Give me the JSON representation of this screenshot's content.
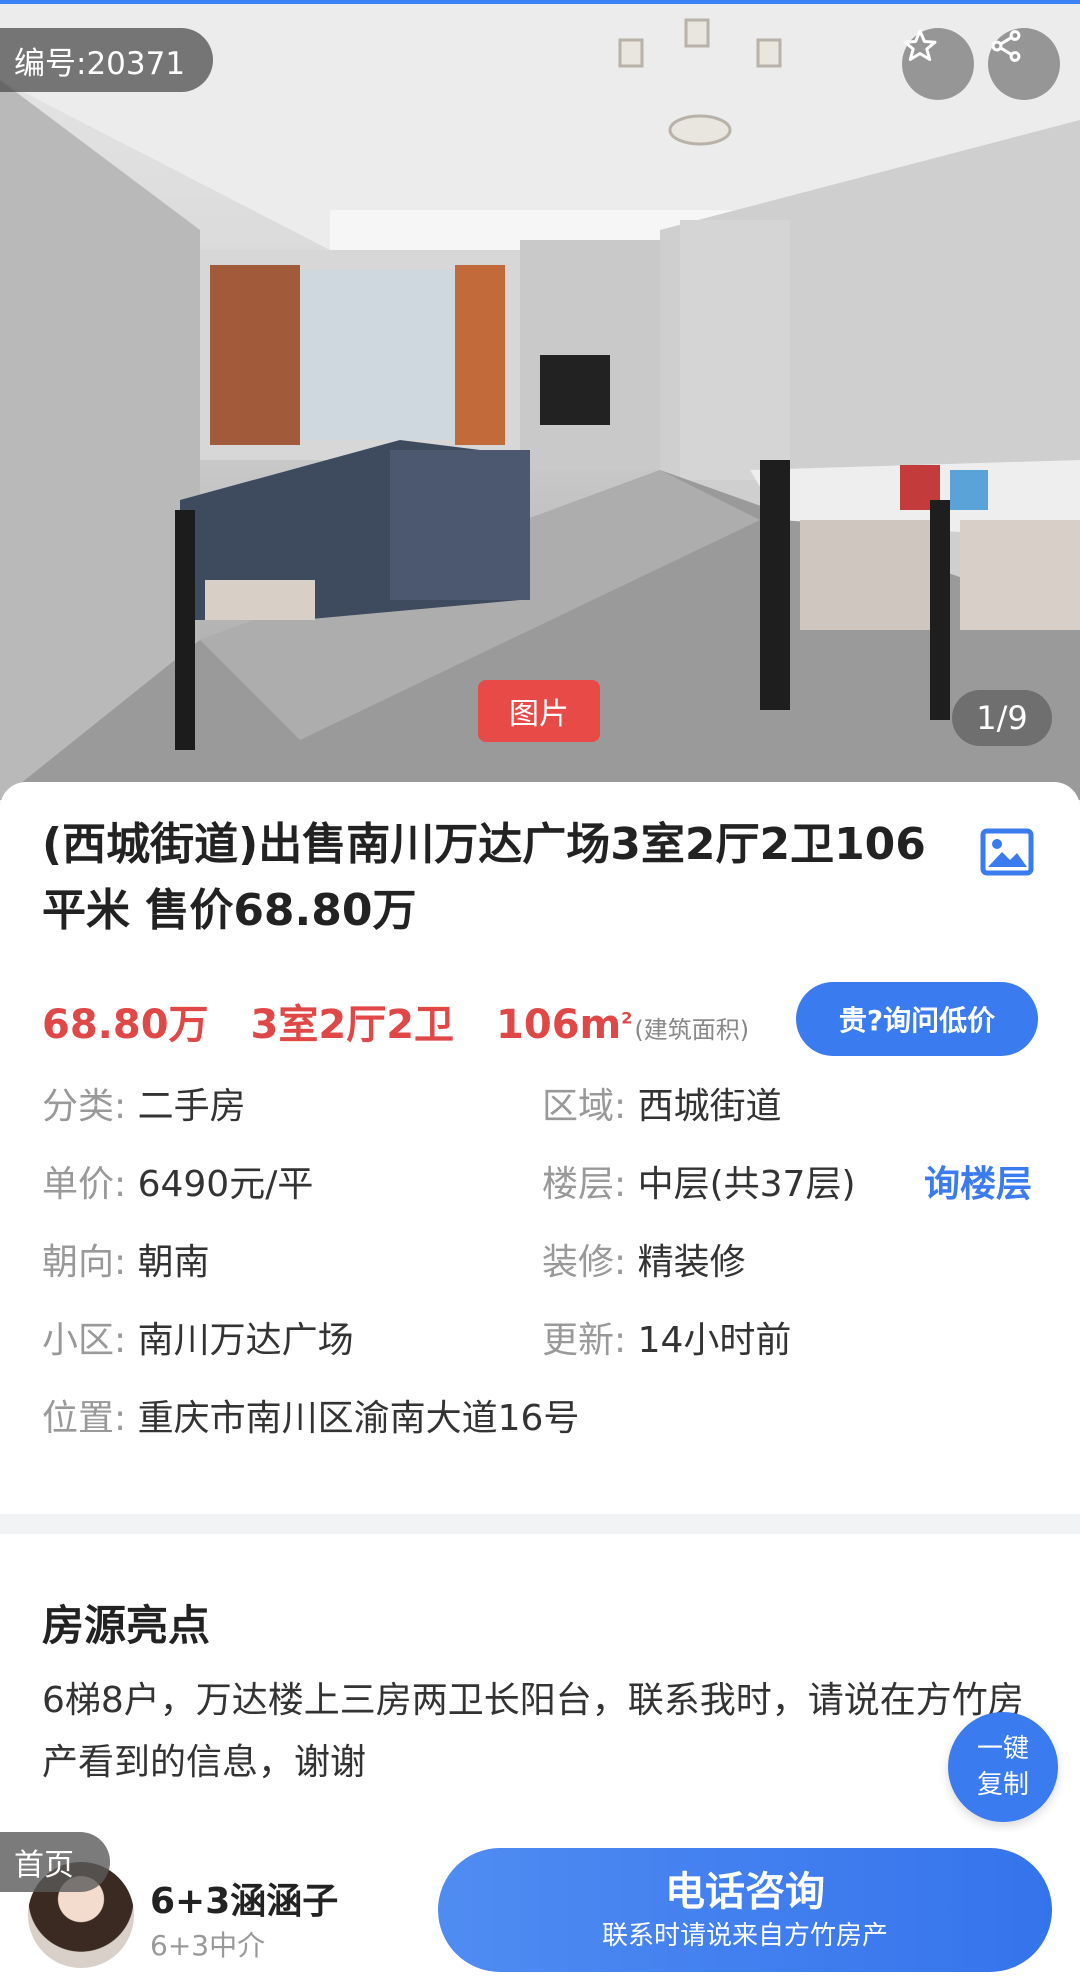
{
  "photo": {
    "code_label": "编号:20371",
    "image_tag": "图片",
    "counter": "1/9",
    "icons": [
      "star-icon",
      "share-icon"
    ]
  },
  "listing": {
    "title": "(西城街道)出售南川万达广场3室2厅2卫106平米 售价68.80万",
    "price": "68.80万",
    "layout": "3室2厅2卫",
    "area": "106m",
    "area_sup": "2",
    "area_note": "(建筑面积)",
    "ask_price_button": "贵?询问低价",
    "ask_floor_button": "询楼层",
    "attributes": [
      {
        "label": "分类:",
        "value": "二手房"
      },
      {
        "label": "区域:",
        "value": "西城街道"
      },
      {
        "label": "单价:",
        "value": "6490元/平"
      },
      {
        "label": "楼层:",
        "value": "中层(共37层)"
      },
      {
        "label": "朝向:",
        "value": "朝南"
      },
      {
        "label": "装修:",
        "value": "精装修"
      },
      {
        "label": "小区:",
        "value": "南川万达广场"
      },
      {
        "label": "更新:",
        "value": "14小时前"
      },
      {
        "label": "位置:",
        "value": "重庆市南川区渝南大道16号"
      }
    ]
  },
  "highlights": {
    "title": "房源亮点",
    "text": "6梯8户，万达楼上三房两卫长阳台，联系我时，请说在方竹房产看到的信息，谢谢",
    "copy_line1": "一键",
    "copy_line2": "复制"
  },
  "bottom_bar": {
    "home_label": "首页",
    "agent_name": "6+3涵涵子",
    "agent_org": "6+3中介",
    "call_label": "电话咨询",
    "call_sub": "联系时请说来自方竹房产"
  },
  "colors": {
    "price_red": "#e04848",
    "accent_blue": "#3a7bef",
    "tag_red": "#e84a48"
  }
}
